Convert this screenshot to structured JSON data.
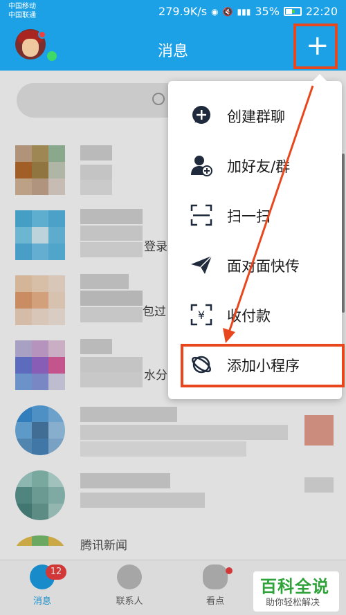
{
  "status_bar": {
    "carrier_1": "中国移动",
    "carrier_2": "中国联通",
    "speed": "279.9K/s",
    "battery": "35%",
    "time": "22:20",
    "icons": [
      "weibo-icon",
      "nfc-icon",
      "mute-icon",
      "hd-icon",
      "eye-icon",
      "signal-icon",
      "wifi-icon",
      "battery-icon"
    ]
  },
  "header": {
    "title": "消息",
    "add_button_label": "+"
  },
  "menu": {
    "items": [
      {
        "label": "创建群聊",
        "icon": "chat-plus-icon"
      },
      {
        "label": "加好友/群",
        "icon": "add-friend-icon"
      },
      {
        "label": "扫一扫",
        "icon": "scan-icon"
      },
      {
        "label": "面对面快传",
        "icon": "paper-plane-icon"
      },
      {
        "label": "收付款",
        "icon": "payment-icon"
      },
      {
        "label": "添加小程序",
        "icon": "mini-program-icon"
      }
    ]
  },
  "list": {
    "partial_texts": [
      "登录",
      "包过",
      "水分"
    ],
    "partial_name": "腾讯新闻"
  },
  "bottom_nav": {
    "items": [
      {
        "label": "消息",
        "badge": "12"
      },
      {
        "label": "联系人"
      },
      {
        "label": "看点"
      }
    ]
  },
  "watermark": {
    "title": "百科全说",
    "subtitle": "助你轻松解决"
  },
  "colors": {
    "brand_blue": "#1ca0e6",
    "highlight_red": "#e8461c",
    "badge_red": "#f04040",
    "watermark_green": "#2fa33a"
  }
}
